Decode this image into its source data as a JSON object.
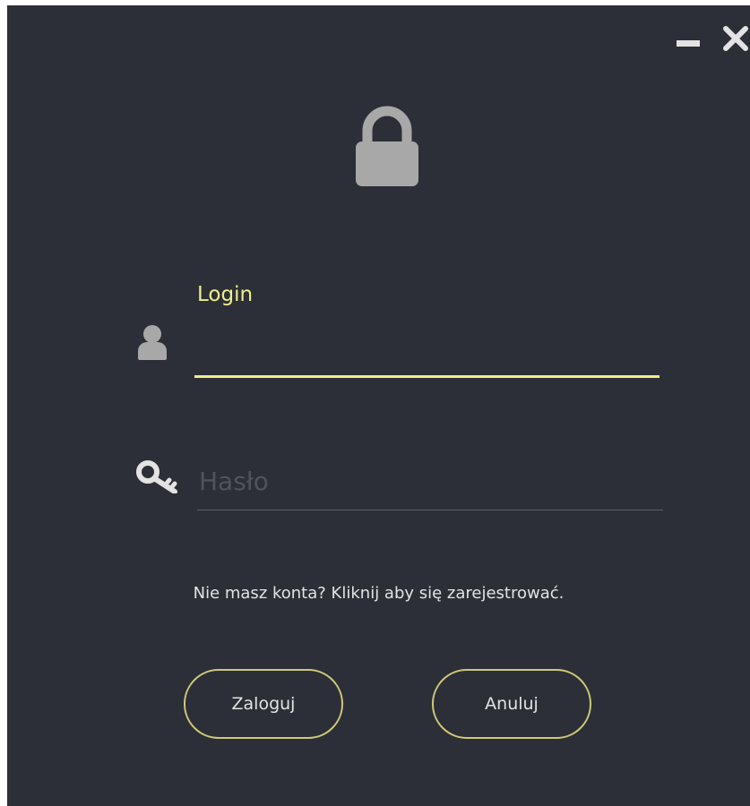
{
  "window": {
    "background": "#2c2f37"
  },
  "controls": {
    "minimize_icon": "minimize-icon",
    "close_icon": "close-icon"
  },
  "header": {
    "icon": "lock-icon"
  },
  "login_field": {
    "label": "Login",
    "value": "",
    "icon": "user-icon",
    "accent_color": "#f0ee8c"
  },
  "password_field": {
    "placeholder": "Hasło",
    "value": "",
    "icon": "key-icon"
  },
  "register_link": {
    "text": "Nie masz konta? Kliknij aby się zarejestrować."
  },
  "buttons": {
    "login_label": "Zaloguj",
    "cancel_label": "Anuluj",
    "border_color": "#cfc979"
  }
}
